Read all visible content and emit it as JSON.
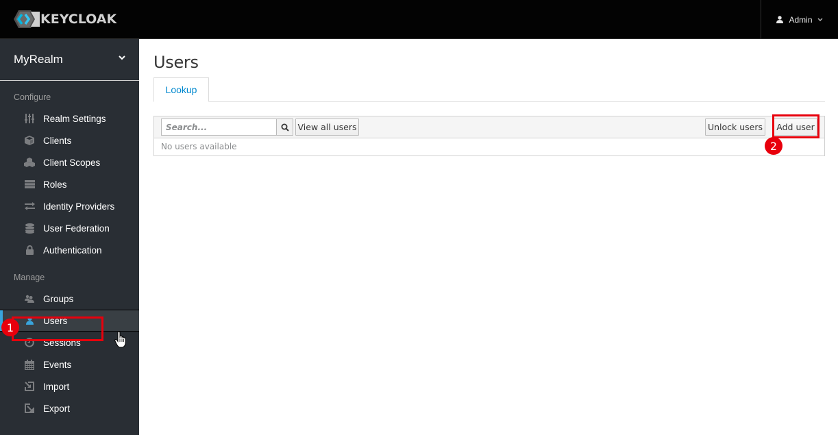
{
  "navbar": {
    "brand": "KEYCLOAK",
    "user_label": "Admin",
    "user_icon": "user-icon",
    "caret_icon": "chevron-down-icon"
  },
  "sidebar": {
    "realm": "MyRealm",
    "sections": [
      {
        "label": "Configure",
        "items": [
          {
            "label": "Realm Settings",
            "icon": "sliders-icon"
          },
          {
            "label": "Clients",
            "icon": "cube-icon"
          },
          {
            "label": "Client Scopes",
            "icon": "cubes-icon"
          },
          {
            "label": "Roles",
            "icon": "server-icon"
          },
          {
            "label": "Identity Providers",
            "icon": "exchange-icon"
          },
          {
            "label": "User Federation",
            "icon": "database-icon"
          },
          {
            "label": "Authentication",
            "icon": "lock-icon"
          }
        ]
      },
      {
        "label": "Manage",
        "items": [
          {
            "label": "Groups",
            "icon": "users-icon"
          },
          {
            "label": "Users",
            "icon": "user-icon",
            "active": true
          },
          {
            "label": "Sessions",
            "icon": "clock-icon"
          },
          {
            "label": "Events",
            "icon": "calendar-icon"
          },
          {
            "label": "Import",
            "icon": "import-icon"
          },
          {
            "label": "Export",
            "icon": "export-icon"
          }
        ]
      }
    ]
  },
  "main": {
    "title": "Users",
    "tabs": [
      {
        "label": "Lookup",
        "active": true
      }
    ],
    "search": {
      "placeholder": "Search...",
      "value": ""
    },
    "buttons": {
      "view_all": "View all users",
      "unlock": "Unlock users",
      "add": "Add user"
    },
    "empty_message": "No users available"
  },
  "annotations": [
    {
      "number": "1",
      "target": "Users"
    },
    {
      "number": "2",
      "target": "Add user"
    }
  ],
  "colors": {
    "accent": "#39a5dc",
    "link": "#0088ce",
    "annotation": "#e8000c",
    "sidebar_bg": "#292e34",
    "navbar_bg": "#030303"
  }
}
